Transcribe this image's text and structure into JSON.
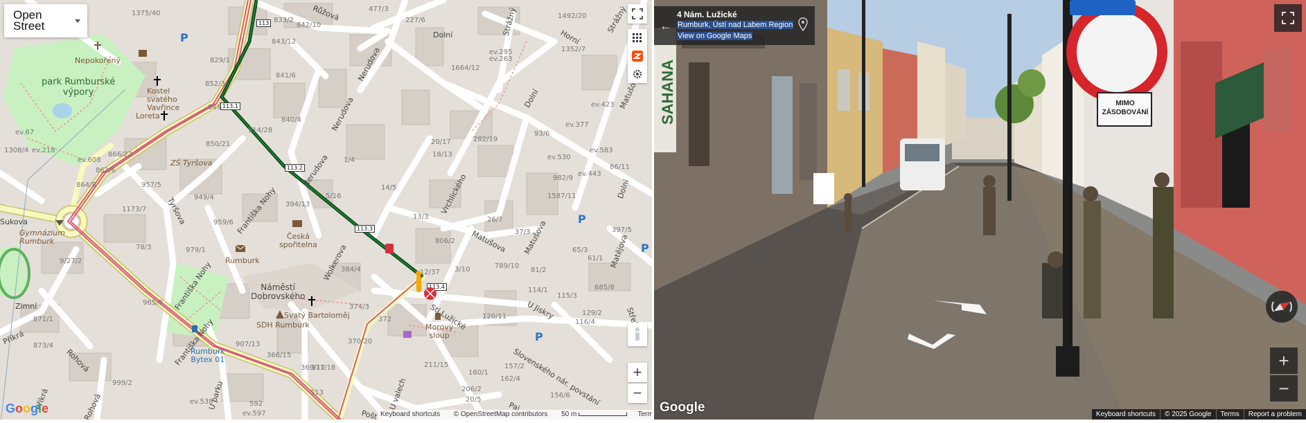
{
  "map": {
    "layer_label": "Open Street",
    "keyboard_shortcuts": "Keyboard shortcuts",
    "osm_attribution": "© OpenStreetMap contributors",
    "scale": "50 m",
    "terms": "Terms",
    "google_logo": "Google",
    "streets": {
      "ruzova": "Růžová",
      "dolni1": "Dolní",
      "horni": "Horní",
      "strazny1": "Strážný",
      "strazny2": "Strážný",
      "nerudova1": "Nerudova",
      "nerudova2": "Nerudova",
      "nerudova3": "Nerudova",
      "dolni2": "Dolní",
      "dolni3": "Dolní",
      "matusova1": "Matušova",
      "matusova2": "Matušova",
      "vrchlickeho": "Vrchlického",
      "frantiskanohy1": "Františka Nohy",
      "frantiskanohy2": "Františka Nohy",
      "frantiskanohy3": "Františka Nohy",
      "tyrsova": "Tyršova",
      "wolkerova": "Wolkerova",
      "sukova": "Sukova",
      "zimni": "Zimní",
      "prikra1": "Příkrá",
      "prikra2": "Příkrá",
      "rohova1": "Rohová",
      "rohova2": "Rohová",
      "uparku": "U parku",
      "uvalech": "U valech",
      "posta": "Pošt",
      "pai": "Pai",
      "ujiskry": "U Jiskry",
      "matejova": "Matějova",
      "strelecka": "Střelec",
      "luzicke": "Sti Lužické",
      "slovenskeho": "Slovenského nár. povstání"
    },
    "pois": {
      "nepokoreny": "Nepokořený",
      "park_line1": "park Rumburské",
      "park_line2": "výpory",
      "kostel_line1": "Kostel",
      "kostel_line2": "svatého",
      "kostel_line3": "Vavřince",
      "loreta": "Loreta",
      "zs": "ZŠ Tyršova",
      "gym_line1": "Gymnázium",
      "gym_line2": "Rumburk",
      "ceska_line1": "Česká",
      "ceska_line2": "spořitelna",
      "rumburk": "Rumburk",
      "namesti_line1": "Náměstí",
      "namesti_line2": "Dobrovského",
      "bartolomej": "Svatý Bartoloměj",
      "sdh": "SDH Rumburk",
      "morovy_line1": "Morový",
      "morovy_line2": "sloup",
      "rumburk_bytex_line1": "Rumburk",
      "rumburk_bytex_line2": "Bytex 01"
    },
    "km_markers": [
      "113",
      "113.1",
      "113.2",
      "113.3",
      "113.4"
    ],
    "addresses": [
      "1375/40",
      "833/2",
      "477/3",
      "227/6",
      "1492/20",
      "1664/12",
      "1352/7",
      "843/12",
      "842/10",
      "ev.295",
      "ev.263",
      "829/1",
      "852/3",
      "841/6",
      "849/12",
      "ev.67",
      "1308/4",
      "ev.218",
      "ev.608",
      "866/22",
      "862/6",
      "864/8",
      "957/5",
      "949/4",
      "914/28",
      "850/21",
      "840/4",
      "20/17",
      "18/13",
      "282/19",
      "93/6",
      "ev.423",
      "ev.377",
      "ev.530",
      "ev.583",
      "ev.443",
      "86/11",
      "982/9",
      "1587/11",
      "394/13",
      "5/16",
      "1/4",
      "14/5",
      "13/3",
      "806/2",
      "26/7",
      "37/3",
      "65/3",
      "61/1",
      "397/5",
      "1173/7",
      "78/3",
      "979/1",
      "959/6",
      "9/27/2",
      "384/4",
      "12/37",
      "3/10",
      "789/10",
      "81/2",
      "114/1",
      "115/3",
      "685/8",
      "129/2",
      "116/4",
      "965/9",
      "374/3",
      "372",
      "370/20",
      "371/18",
      "366/15",
      "369/17",
      "907/13",
      "592",
      "513",
      "871/1",
      "873/4",
      "999/2",
      "ev.538",
      "ev.597",
      "211/15",
      "160/1",
      "157/2",
      "162/4",
      "206/2",
      "20/5",
      "156/6",
      "120/11"
    ]
  },
  "pano": {
    "address_title": "4 Nám. Lužické",
    "address_region": "Rumburk, Ústí nad Labem Region",
    "view_link": "View on Google Maps",
    "sign_text_line1": "MIMO",
    "sign_text_line2": "ZÁSOBOVÁNÍ",
    "shop_sign": "SAHANA",
    "google_logo": "Google",
    "attribution": {
      "shortcuts": "Keyboard shortcuts",
      "copyright": "© 2025 Google",
      "terms": "Terms",
      "report": "Report a problem"
    }
  }
}
